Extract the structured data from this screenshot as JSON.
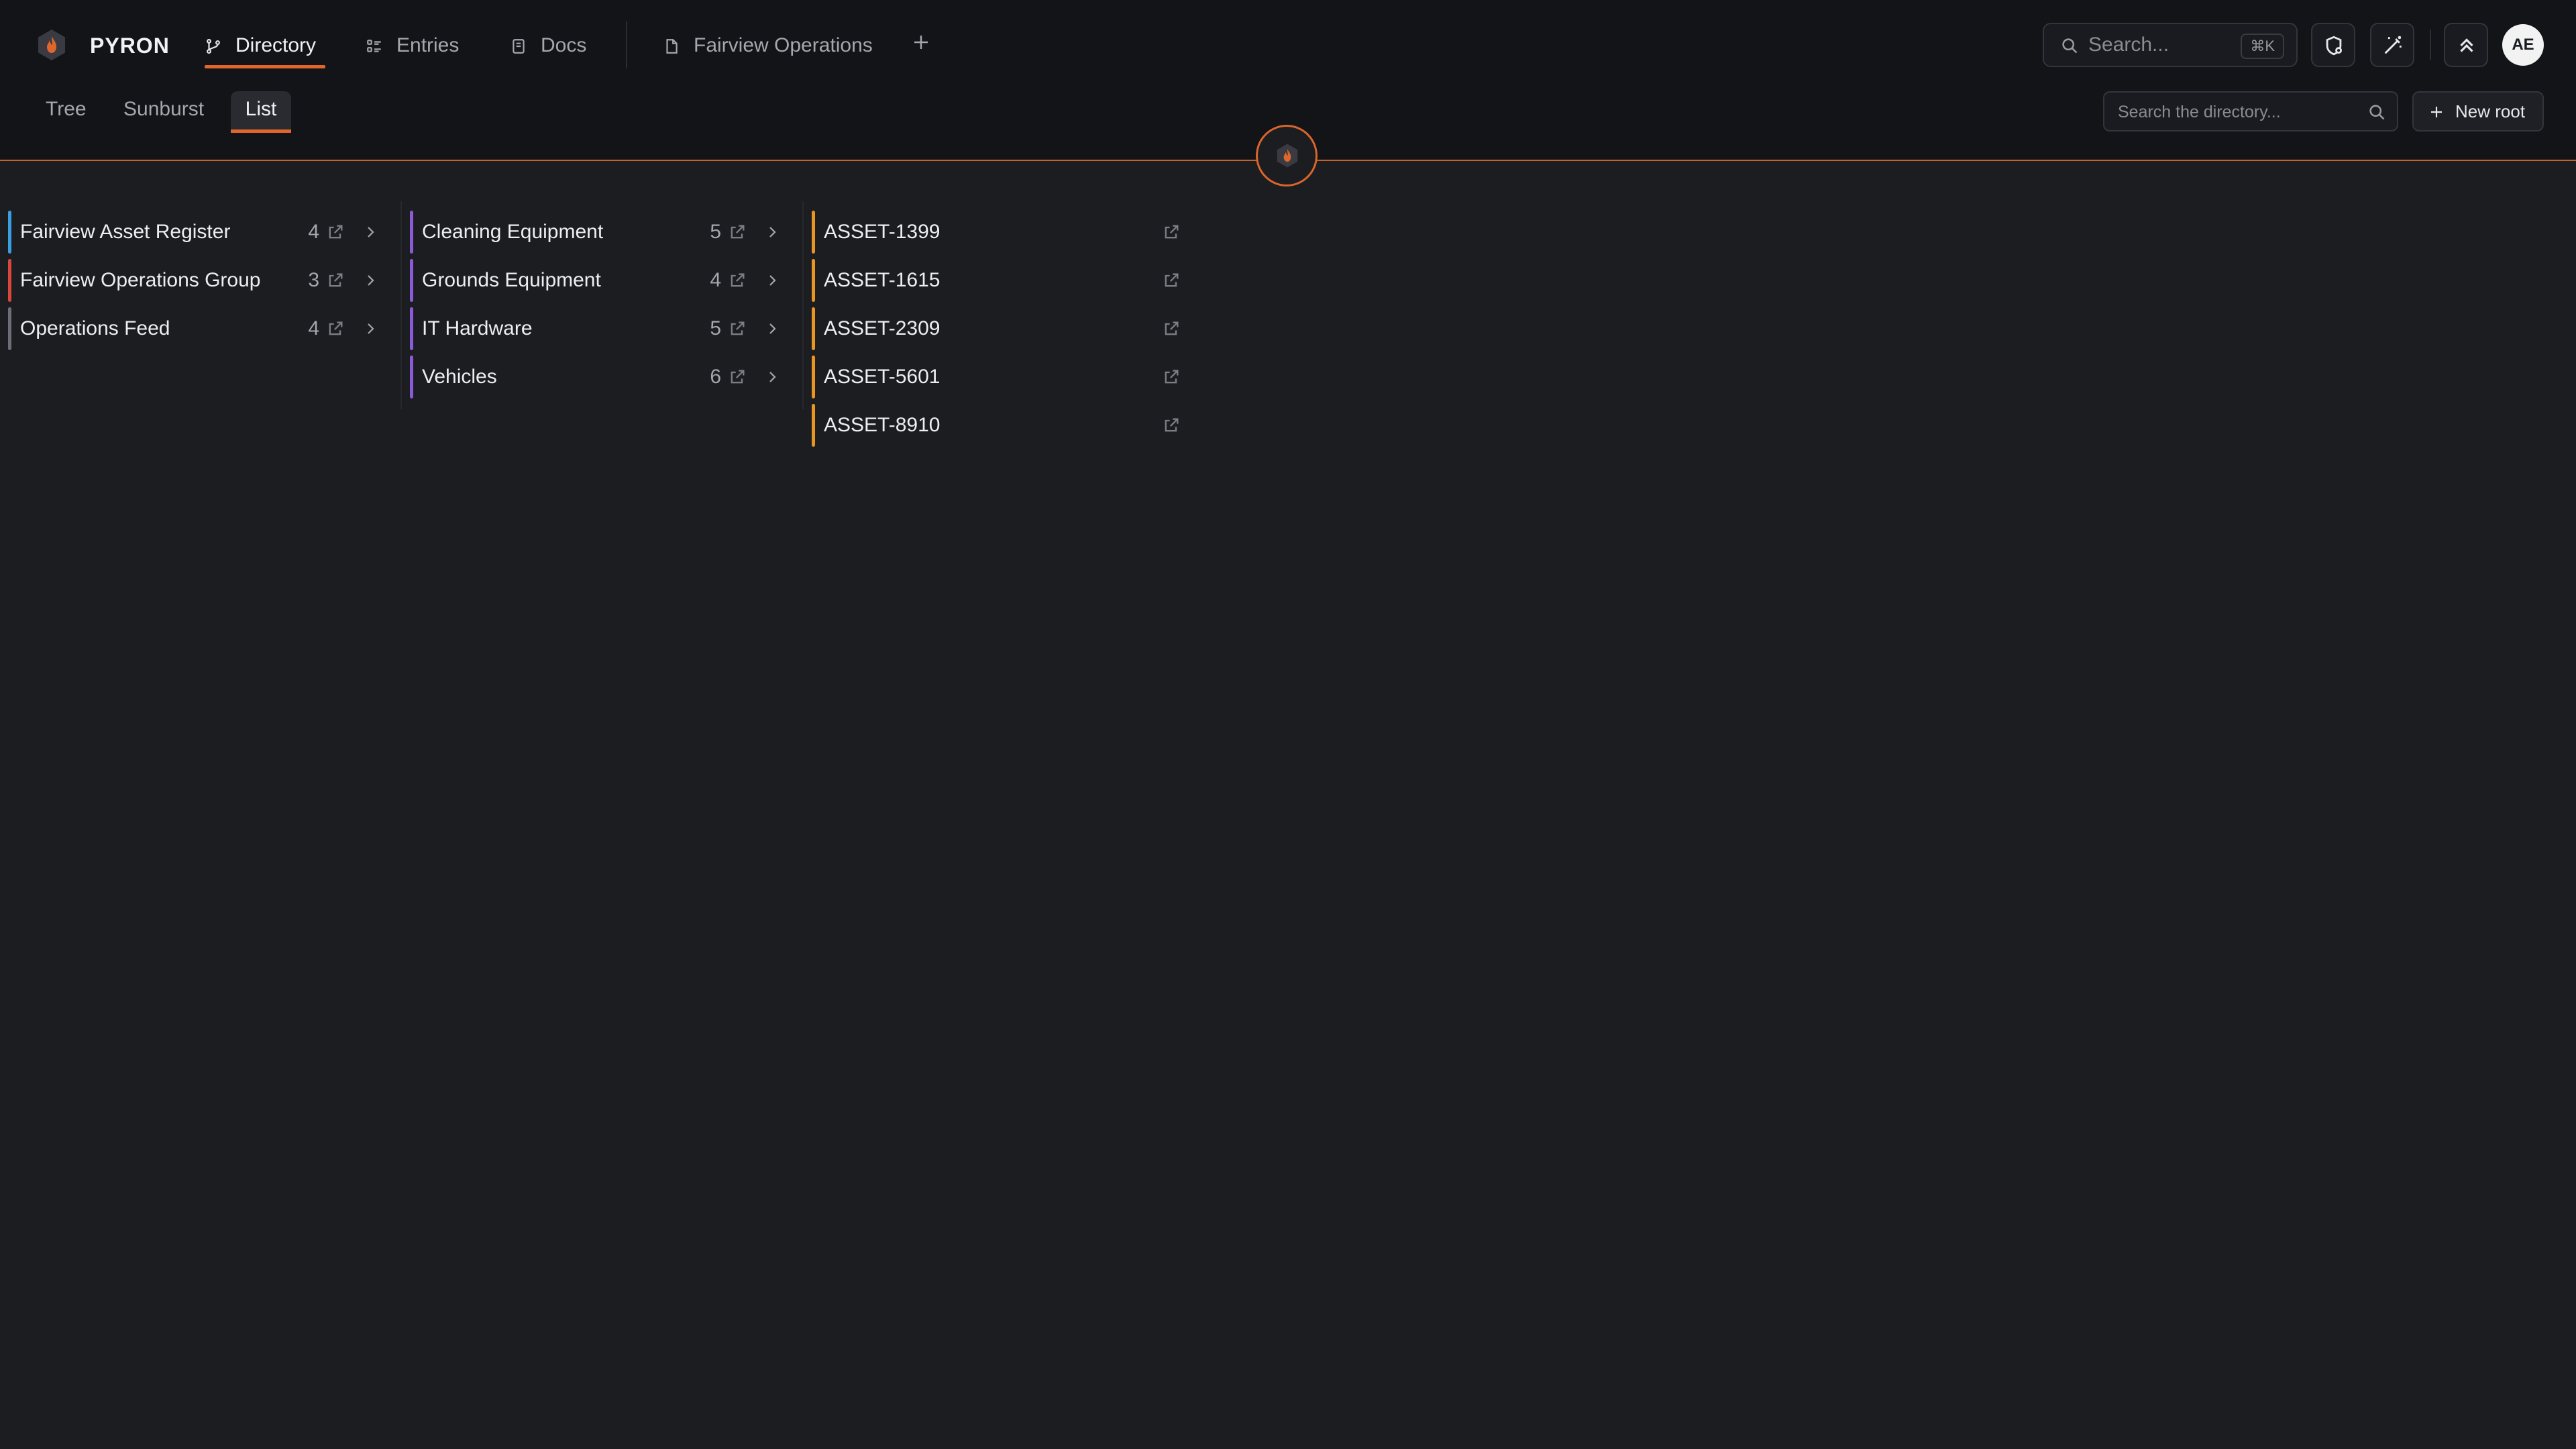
{
  "app": {
    "brand": "PYRON"
  },
  "nav": {
    "tabs": [
      {
        "label": "Directory",
        "icon": "branch-icon",
        "active": true
      },
      {
        "label": "Entries",
        "icon": "list-icon",
        "active": false
      },
      {
        "label": "Docs",
        "icon": "book-icon",
        "active": false
      }
    ],
    "open_doc": {
      "label": "Fairview Operations",
      "icon": "file-icon"
    }
  },
  "global_search": {
    "placeholder": "Search...",
    "shortcut": "⌘K"
  },
  "user": {
    "initials": "AE"
  },
  "view_tabs": [
    {
      "label": "Tree",
      "active": false
    },
    {
      "label": "Sunburst",
      "active": false
    },
    {
      "label": "List",
      "active": true
    }
  ],
  "directory_search": {
    "placeholder": "Search the directory..."
  },
  "new_root": {
    "label": "New root"
  },
  "colors": {
    "accent": "#e0662c",
    "blue": "#3a9fe0",
    "red": "#d9463b",
    "gray": "#6b6e78",
    "purple": "#8b5ad6",
    "orange": "#e8961f"
  },
  "columns": [
    {
      "items": [
        {
          "name": "Fairview Asset Register",
          "count": "4",
          "color": "#3a9fe0"
        },
        {
          "name": "Fairview Operations Group",
          "count": "3",
          "color": "#d9463b"
        },
        {
          "name": "Operations Feed",
          "count": "4",
          "color": "#6b6e78"
        }
      ]
    },
    {
      "items": [
        {
          "name": "Cleaning Equipment",
          "count": "5",
          "color": "#8b5ad6"
        },
        {
          "name": "Grounds Equipment",
          "count": "4",
          "color": "#8b5ad6"
        },
        {
          "name": "IT Hardware",
          "count": "5",
          "color": "#8b5ad6"
        },
        {
          "name": "Vehicles",
          "count": "6",
          "color": "#8b5ad6"
        }
      ]
    },
    {
      "items": [
        {
          "name": "ASSET-1399",
          "color": "#e8961f"
        },
        {
          "name": "ASSET-1615",
          "color": "#e8961f"
        },
        {
          "name": "ASSET-2309",
          "color": "#e8961f"
        },
        {
          "name": "ASSET-5601",
          "color": "#e8961f"
        },
        {
          "name": "ASSET-8910",
          "color": "#e8961f"
        }
      ]
    }
  ]
}
